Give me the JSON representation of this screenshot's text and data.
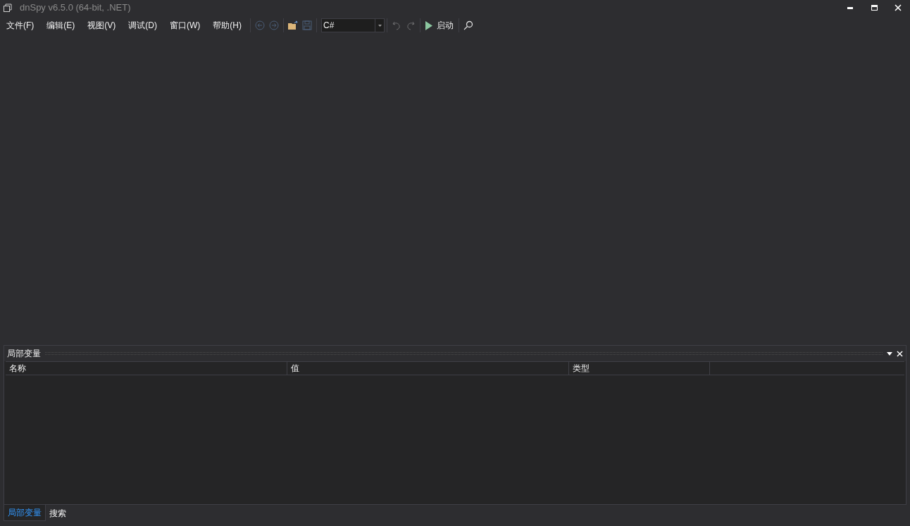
{
  "window": {
    "title": "dnSpy v6.5.0 (64-bit, .NET)"
  },
  "menu": [
    "文件(F)",
    "编辑(E)",
    "视图(V)",
    "调试(D)",
    "窗口(W)",
    "帮助(H)"
  ],
  "toolbar": {
    "back_disabled": true,
    "forward_disabled": true,
    "save_disabled": true,
    "language": "C#",
    "undo_disabled": true,
    "redo_disabled": true,
    "start_label": "启动"
  },
  "panel": {
    "title": "局部变量",
    "columns": [
      "名称",
      "值",
      "类型"
    ]
  },
  "bottom_tabs": [
    {
      "label": "局部变量",
      "selected": true
    },
    {
      "label": "搜索",
      "selected": false
    }
  ]
}
